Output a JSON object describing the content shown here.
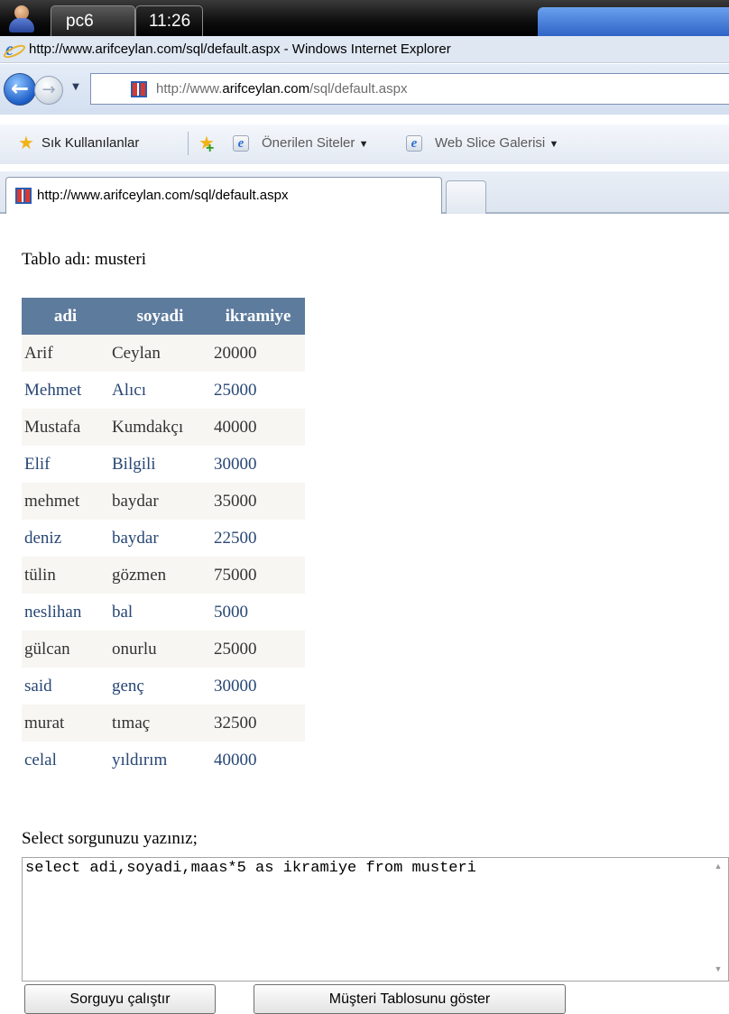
{
  "taskbar": {
    "user_label": "pc6",
    "clock": "11:26"
  },
  "window": {
    "title": "http://www.arifceylan.com/sql/default.aspx - Windows Internet Explorer"
  },
  "address_bar": {
    "prefix": "http://www.",
    "domain": "arifceylan.com",
    "path": "/sql/default.aspx"
  },
  "favorites_bar": {
    "favorites_label": "Sık Kullanılanlar",
    "suggested_sites_label": "Önerilen Siteler",
    "web_slice_label": "Web Slice Galerisi"
  },
  "tab": {
    "label": "http://www.arifceylan.com/sql/default.aspx"
  },
  "page": {
    "table_name_label": "Tablo adı: musteri",
    "columns": [
      "adi",
      "soyadi",
      "ikramiye"
    ],
    "rows": [
      [
        "Arif",
        "Ceylan",
        "20000"
      ],
      [
        "Mehmet",
        "Alıcı",
        "25000"
      ],
      [
        "Mustafa",
        "Kumdakçı",
        "40000"
      ],
      [
        "Elif",
        "Bilgili",
        "30000"
      ],
      [
        "mehmet",
        "baydar",
        "35000"
      ],
      [
        "deniz",
        "baydar",
        "22500"
      ],
      [
        "tülin",
        "gözmen",
        "75000"
      ],
      [
        "neslihan",
        "bal",
        "5000"
      ],
      [
        "gülcan",
        "onurlu",
        "25000"
      ],
      [
        "said",
        "genç",
        "30000"
      ],
      [
        "murat",
        "tımaç",
        "32500"
      ],
      [
        "celal",
        "yıldırım",
        "40000"
      ]
    ],
    "query_label": "Select sorgunuzu yazınız;",
    "query_text": "select adi,soyadi,maas*5 as ikramiye from musteri",
    "run_button": "Sorguyu çalıştır",
    "show_table_button": "Müşteri Tablosunu göster"
  },
  "colors": {
    "header_bg": "#5d7b9d",
    "odd_row_bg": "#f7f6f3",
    "odd_row_text": "#333333",
    "even_row_text": "#284775"
  },
  "icons": {
    "user": "user-avatar-icon",
    "browser": "internet-explorer-icon",
    "back": "back-arrow-icon",
    "forward": "forward-arrow-icon",
    "favorites": "star-icon",
    "add_favorite": "add-favorite-icon",
    "site": "site-favicon-icon"
  }
}
